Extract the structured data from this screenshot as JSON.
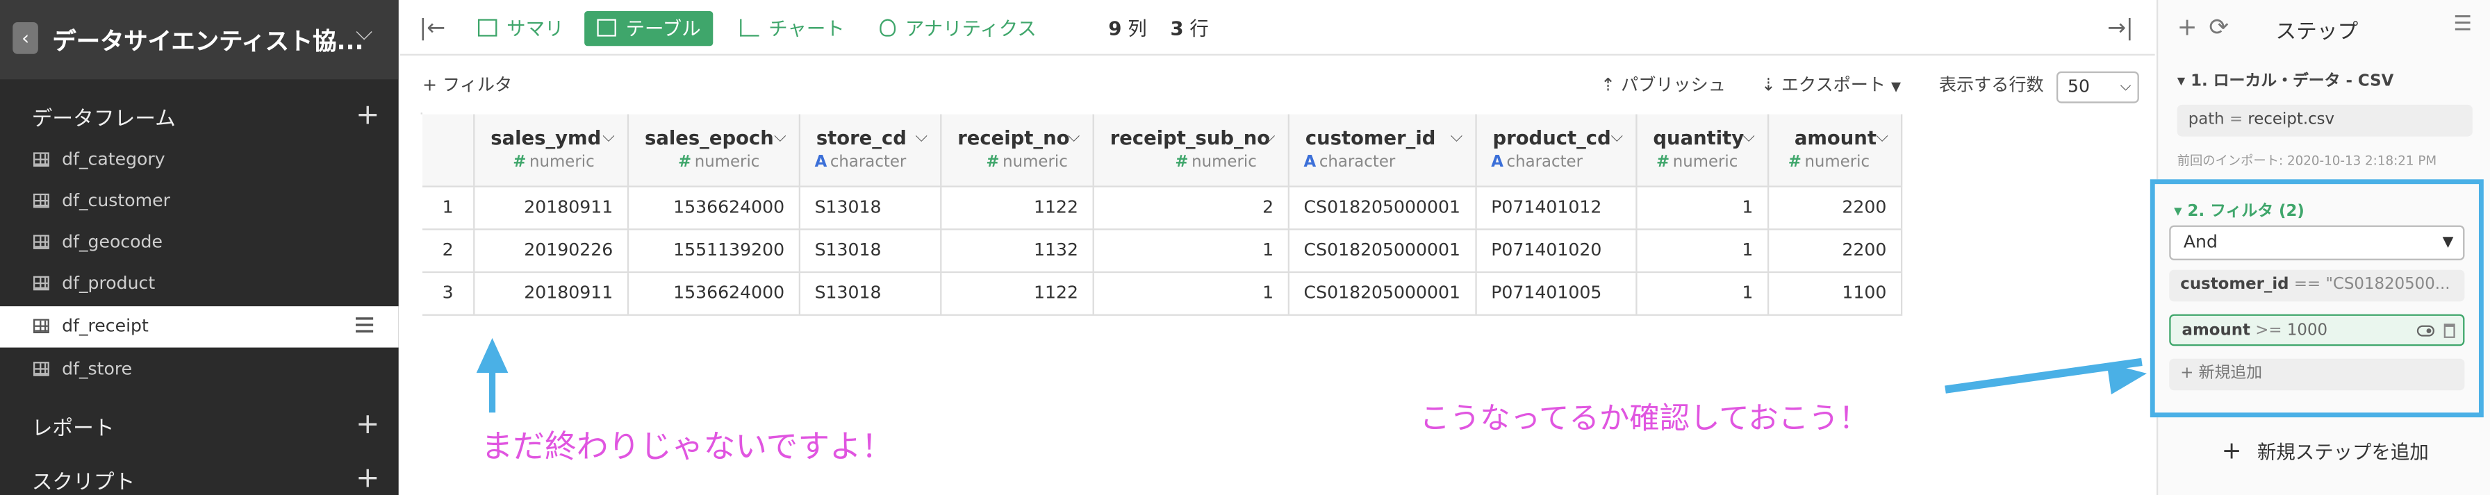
{
  "sidebar": {
    "back_icon": "chevron-left-icon",
    "project_title": "データサイエンティスト協...",
    "sections": {
      "dataframes": "データフレーム",
      "reports": "レポート",
      "scripts": "スクリプト"
    },
    "dataframes": [
      {
        "label": "df_category"
      },
      {
        "label": "df_customer"
      },
      {
        "label": "df_geocode"
      },
      {
        "label": "df_product"
      },
      {
        "label": "df_receipt",
        "active": true
      },
      {
        "label": "df_store"
      }
    ],
    "plus": "+"
  },
  "toolbar": {
    "summary": "サマリ",
    "table": "テーブル",
    "chart": "チャート",
    "analytics": "アナリティクス",
    "cols_count": "9",
    "cols_unit": "列",
    "rows_count": "3",
    "rows_unit": "行"
  },
  "filterbar": {
    "add_filter": "+ フィルタ",
    "publish": "パブリッシュ",
    "export": "エクスポート",
    "rows_label": "表示する行数",
    "rows_value": "50"
  },
  "table": {
    "columns": [
      {
        "name": "sales_ymd",
        "type_mark": "#",
        "type": "numeric"
      },
      {
        "name": "sales_epoch",
        "type_mark": "#",
        "type": "numeric"
      },
      {
        "name": "store_cd",
        "type_mark": "A",
        "type": "character"
      },
      {
        "name": "receipt_no",
        "type_mark": "#",
        "type": "numeric"
      },
      {
        "name": "receipt_sub_no",
        "type_mark": "#",
        "type": "numeric"
      },
      {
        "name": "customer_id",
        "type_mark": "A",
        "type": "character"
      },
      {
        "name": "product_cd",
        "type_mark": "A",
        "type": "character"
      },
      {
        "name": "quantity",
        "type_mark": "#",
        "type": "numeric"
      },
      {
        "name": "amount",
        "type_mark": "#",
        "type": "numeric"
      }
    ],
    "rows": [
      [
        "1",
        "20180911",
        "1536624000",
        "S13018",
        "1122",
        "2",
        "CS018205000001",
        "P071401012",
        "1",
        "2200"
      ],
      [
        "2",
        "20190226",
        "1551139200",
        "S13018",
        "1132",
        "1",
        "CS018205000001",
        "P071401020",
        "1",
        "2200"
      ],
      [
        "3",
        "20180911",
        "1536624000",
        "S13018",
        "1122",
        "1",
        "CS018205000001",
        "P071401005",
        "1",
        "1100"
      ]
    ]
  },
  "annotations": {
    "note_left": "まだ終わりじゃないですよ！",
    "note_right": "こうなってるか確認しておこう！",
    "accent_color": "#4ab0e6",
    "text_color": "#e055e0"
  },
  "steps": {
    "title": "ステップ",
    "step1": {
      "title": "▾ 1. ローカル・データ - CSV",
      "param_key": "path",
      "param_op": "=",
      "param_val": "receipt.csv",
      "hint": "前回のインポート: 2020-10-13 2:18:21 PM"
    },
    "step2": {
      "title": "▾ 2. フィルタ (2)",
      "logic": "And",
      "cond1_key": "customer_id",
      "cond1_op": "==",
      "cond1_val": "\"CS01820500...",
      "cond2_key": "amount",
      "cond2_op": ">=",
      "cond2_val": "1000",
      "add_new": "+ 新規追加"
    },
    "add_step": "新規ステップを追加"
  },
  "colors": {
    "green": "#3fa66b",
    "sidebar_bg": "#2b2b2b"
  }
}
